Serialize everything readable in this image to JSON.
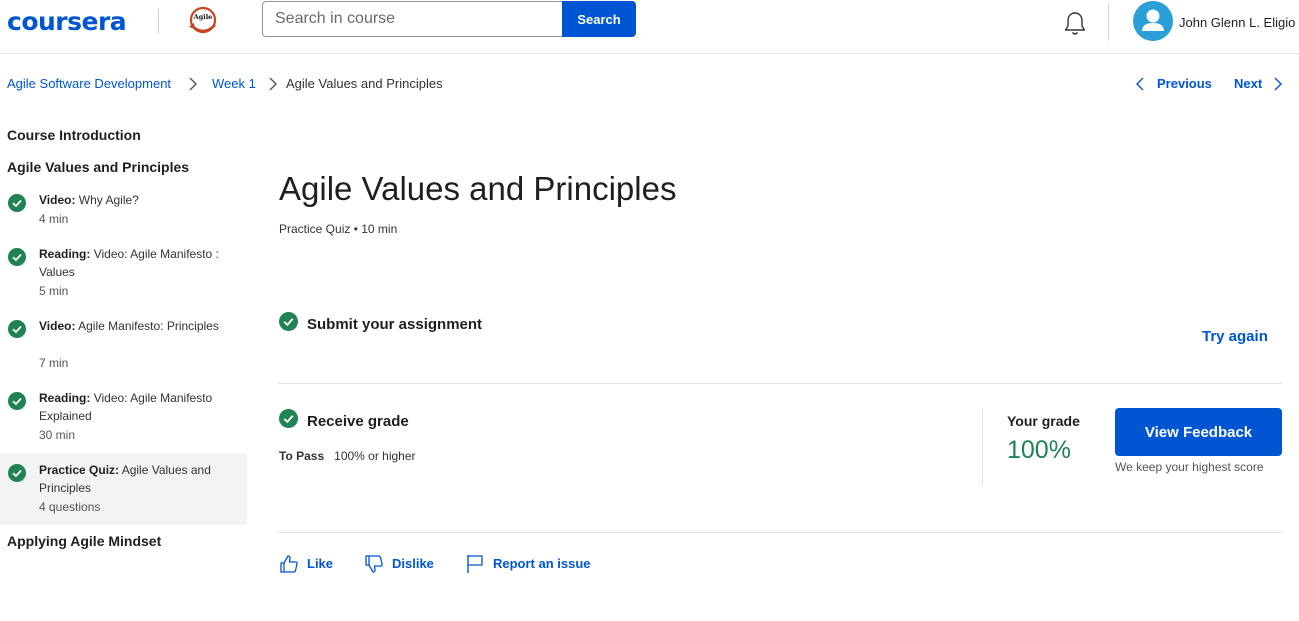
{
  "header": {
    "logo_text": "coursera",
    "partner_logo_label": "Agile",
    "search": {
      "placeholder": "Search in course",
      "button_label": "Search"
    },
    "user_name": "John Glenn L. Eligio"
  },
  "breadcrumb": {
    "items": [
      "Agile Software Development",
      "Week 1",
      "Agile Values and Principles"
    ],
    "previous_label": "Previous",
    "next_label": "Next"
  },
  "sidebar": {
    "sections": [
      "Course Introduction",
      "Agile Values and Principles",
      "Applying Agile Mindset"
    ],
    "items": [
      {
        "type": "Video:",
        "title": "Why Agile?",
        "meta": "4 min",
        "completed": true,
        "active": false
      },
      {
        "type": "Reading:",
        "title": "Video: Agile Manifesto : Values",
        "meta": "5 min",
        "completed": true,
        "active": false
      },
      {
        "type": "Video:",
        "title": "Agile Manifesto: Principles",
        "meta": "7 min",
        "completed": true,
        "active": false
      },
      {
        "type": "Reading:",
        "title": "Video: Agile Manifesto Explained",
        "meta": "30 min",
        "completed": true,
        "active": false
      },
      {
        "type": "Practice Quiz:",
        "title": "Agile Values and Principles",
        "meta": "4 questions",
        "completed": true,
        "active": true
      }
    ]
  },
  "main": {
    "title": "Agile Values and Principles",
    "subtitle": "Practice Quiz • 10 min",
    "submit": {
      "title": "Submit your assignment",
      "action_label": "Try again"
    },
    "grade": {
      "title": "Receive grade",
      "to_pass_label": "To Pass",
      "to_pass_value": "100% or higher",
      "your_grade_label": "Your grade",
      "your_grade_value": "100%",
      "feedback_button": "View Feedback",
      "note": "We keep your highest score"
    },
    "actions": {
      "like": "Like",
      "dislike": "Dislike",
      "report": "Report an issue"
    }
  },
  "colors": {
    "brand": "#0056d2",
    "success": "#1f8354",
    "avatar": "#2a9fd8"
  }
}
